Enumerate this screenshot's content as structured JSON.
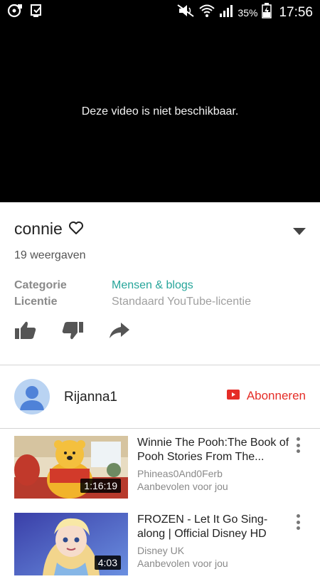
{
  "status_bar": {
    "battery_percent": "35%",
    "time": "17:56",
    "icons": [
      "notification-icon",
      "screen-icon",
      "mute-icon",
      "wifi-icon",
      "signal-icon",
      "battery-icon"
    ]
  },
  "player": {
    "message": "Deze video is niet beschikbaar."
  },
  "video": {
    "title": "connie",
    "views": "19 weergaven",
    "meta": [
      {
        "key": "Categorie",
        "value": "Mensen & blogs"
      },
      {
        "key": "Licentie",
        "value": "Standaard YouTube-licentie"
      }
    ]
  },
  "channel": {
    "name": "Rijanna1",
    "subscribe_label": "Abonneren"
  },
  "recommendations": [
    {
      "title": "Winnie The Pooh:The Book of Pooh Stories From The...",
      "channel": "Phineas0And0Ferb",
      "reason": "Aanbevolen voor jou",
      "duration": "1:16:19"
    },
    {
      "title": "FROZEN - Let It Go Sing-along | Official Disney HD",
      "channel": "Disney UK",
      "reason": "Aanbevolen voor jou",
      "duration": "4:03"
    }
  ],
  "colors": {
    "accent_link": "#26a59a",
    "subscribe_red": "#e52d27"
  }
}
